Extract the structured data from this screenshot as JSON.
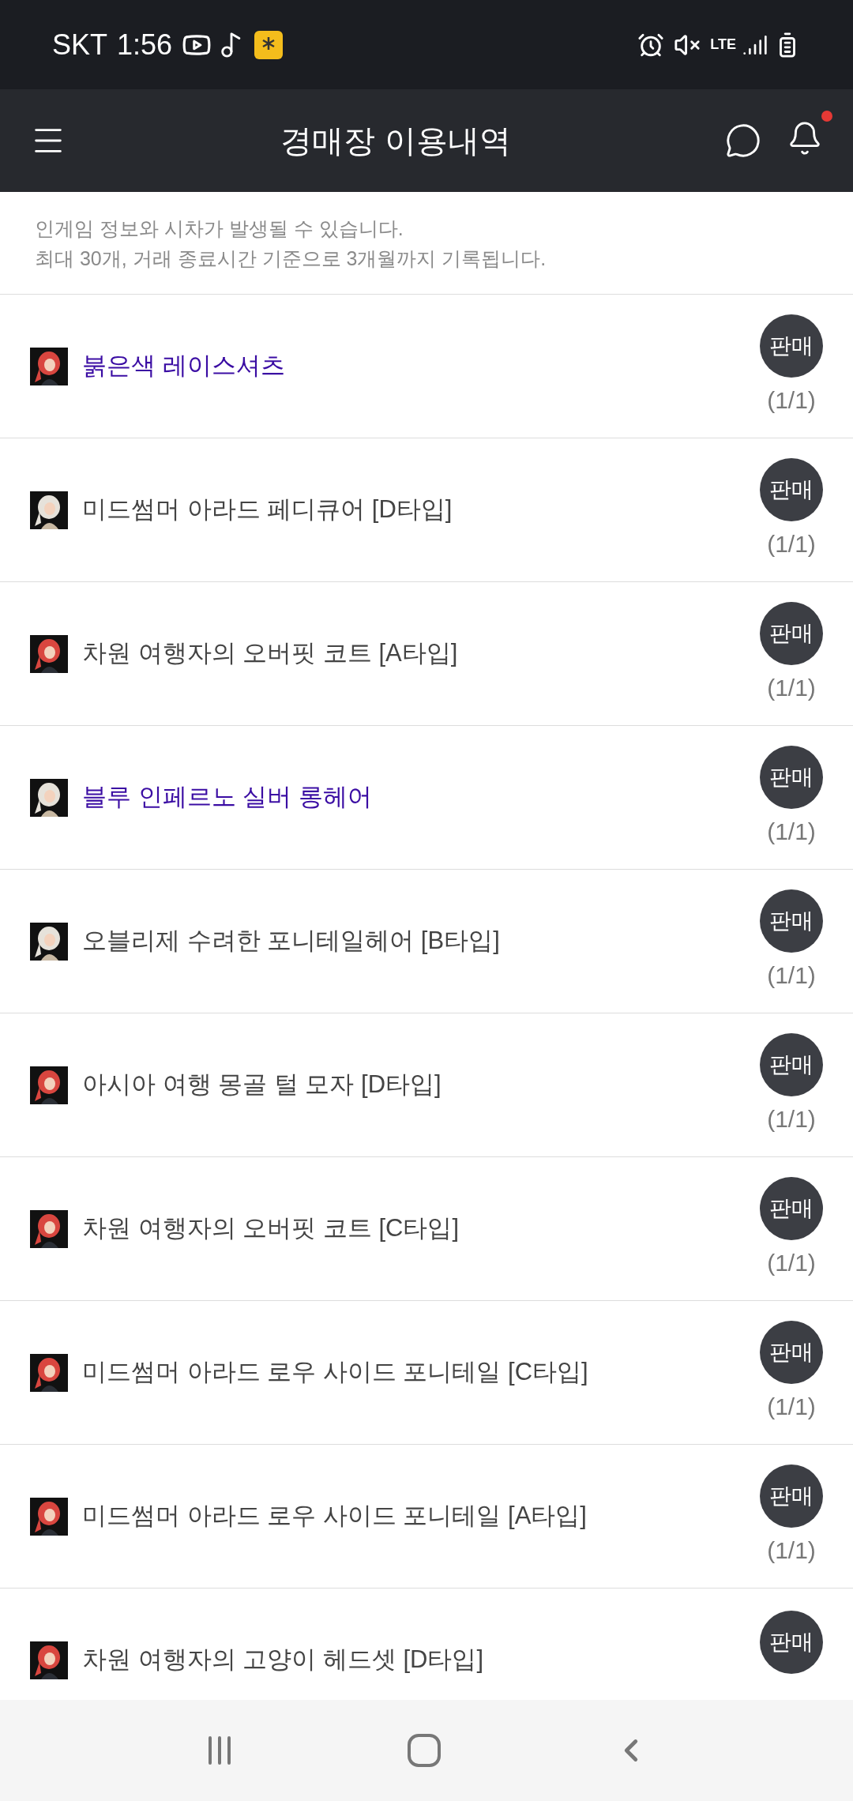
{
  "status_bar": {
    "carrier": "SKT",
    "time": "1:56",
    "network": "LTE"
  },
  "header": {
    "title": "경매장 이용내역",
    "notification_dot": true
  },
  "notice": [
    "인게임 정보와 시차가 발생될 수 있습니다.",
    "최대 30개, 거래 종료시간 기준으로 3개월까지 기록됩니다."
  ],
  "items": [
    {
      "name": "붉은색 레이스셔츠",
      "highlighted": true,
      "kind": "red",
      "badge": "판매",
      "count": "(1/1)"
    },
    {
      "name": "미드썸머 아라드 페디큐어 [D타입]",
      "highlighted": false,
      "kind": "white",
      "badge": "판매",
      "count": "(1/1)"
    },
    {
      "name": "차원 여행자의 오버핏 코트 [A타입]",
      "highlighted": false,
      "kind": "red",
      "badge": "판매",
      "count": "(1/1)"
    },
    {
      "name": "블루 인페르노 실버 롱헤어",
      "highlighted": true,
      "kind": "white",
      "badge": "판매",
      "count": "(1/1)"
    },
    {
      "name": "오블리제 수려한 포니테일헤어  [B타입]",
      "highlighted": false,
      "kind": "white",
      "badge": "판매",
      "count": "(1/1)"
    },
    {
      "name": "아시아 여행 몽골 털 모자 [D타입]",
      "highlighted": false,
      "kind": "red",
      "badge": "판매",
      "count": "(1/1)"
    },
    {
      "name": "차원 여행자의 오버핏 코트 [C타입]",
      "highlighted": false,
      "kind": "red",
      "badge": "판매",
      "count": "(1/1)"
    },
    {
      "name": "미드썸머 아라드 로우 사이드 포니테일 [C타입]",
      "highlighted": false,
      "kind": "red",
      "badge": "판매",
      "count": "(1/1)"
    },
    {
      "name": "미드썸머 아라드 로우 사이드 포니테일 [A타입]",
      "highlighted": false,
      "kind": "red",
      "badge": "판매",
      "count": "(1/1)"
    },
    {
      "name": "차원 여행자의 고양이 헤드셋 [D타입]",
      "highlighted": false,
      "kind": "red",
      "badge": "판매"
    }
  ]
}
